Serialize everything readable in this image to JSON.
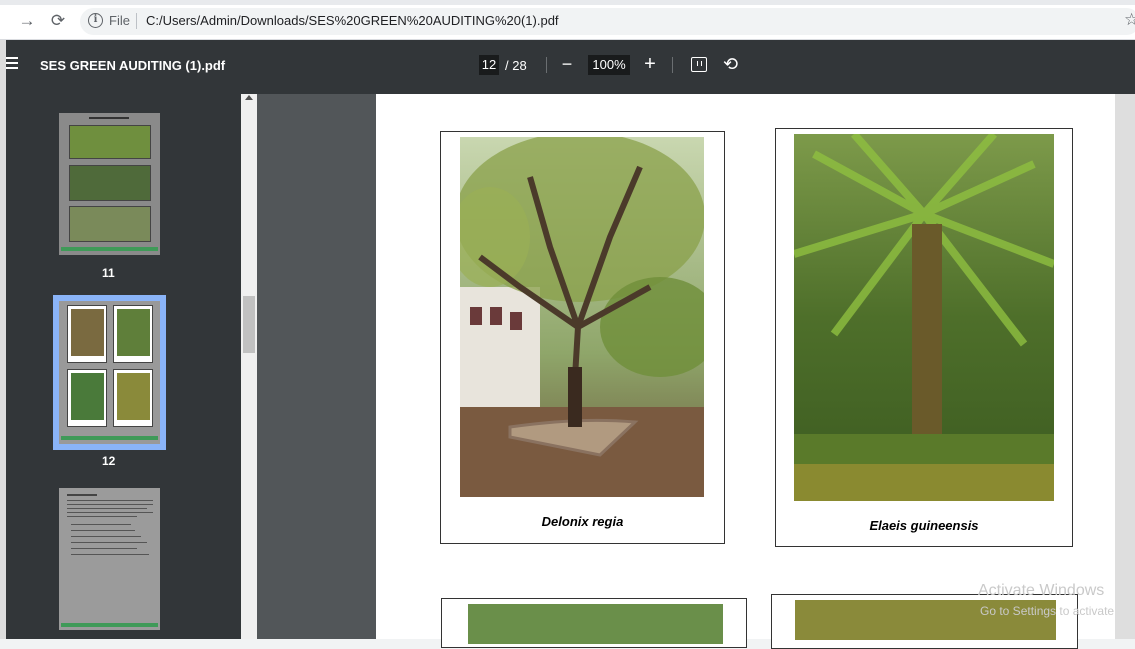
{
  "browser": {
    "scheme": "File",
    "url": "C:/Users/Admin/Downloads/SES%20GREEN%20AUDITING%20(1).pdf"
  },
  "toolbar": {
    "title": "SES GREEN AUDITING (1).pdf",
    "page_current": "12",
    "page_total": "/ 28",
    "zoom": "100%"
  },
  "sidebar": {
    "thumbnails": [
      {
        "label": "11"
      },
      {
        "label": "12"
      }
    ]
  },
  "page": {
    "captions": [
      "Delonix regia",
      "Elaeis guineensis"
    ]
  },
  "watermark": {
    "line1": "Activate Windows",
    "line2": "Go to Settings to activate"
  },
  "colors": {
    "toolbar_bg": "#323639",
    "viewer_bg": "#525659",
    "selected_thumb": "#8ab4f8"
  }
}
